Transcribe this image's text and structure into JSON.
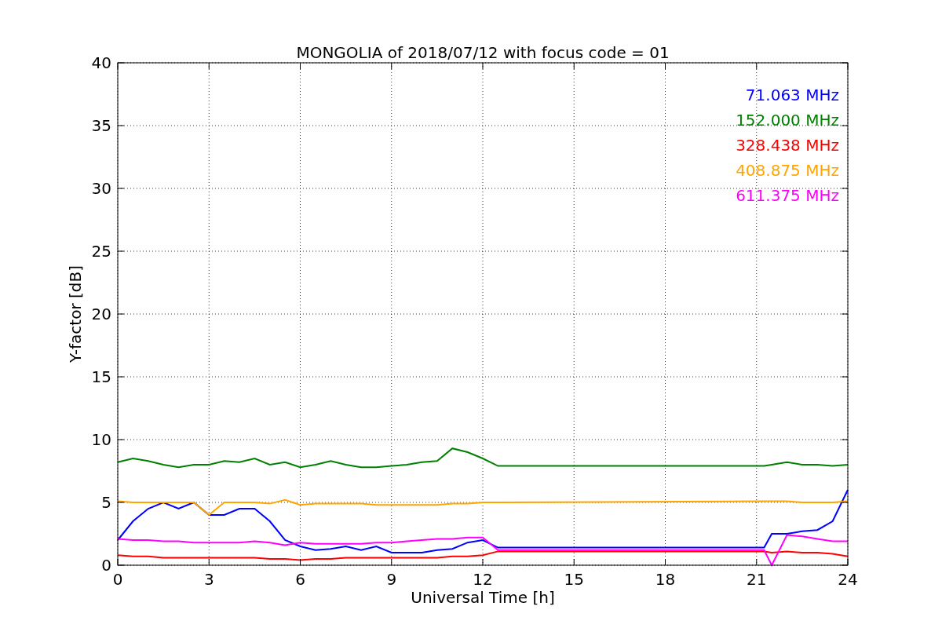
{
  "figure": {
    "chart_data": {
      "type": "line",
      "title": "MONGOLIA of 2018/07/12 with focus code = 01",
      "xlabel": "Universal Time [h]",
      "ylabel": "Y-factor [dB]",
      "xlim": [
        0,
        24
      ],
      "ylim": [
        0,
        40
      ],
      "xticks": [
        0,
        3,
        6,
        9,
        12,
        15,
        18,
        21,
        24
      ],
      "yticks": [
        0,
        5,
        10,
        15,
        20,
        25,
        30,
        35,
        40
      ],
      "grid": true,
      "x": [
        0,
        0.5,
        1,
        1.5,
        2,
        2.5,
        3,
        3.5,
        4,
        4.5,
        5,
        5.5,
        6,
        6.5,
        7,
        7.5,
        8,
        8.5,
        9,
        9.5,
        10,
        10.5,
        11,
        11.5,
        12,
        12.5,
        21.25,
        21.5,
        22,
        22.5,
        23,
        23.5,
        24
      ],
      "series": [
        {
          "name": "71.063 MHz",
          "color": "#0000ff",
          "values": [
            2,
            3.5,
            4.5,
            5,
            4.5,
            5,
            4,
            4,
            4.5,
            4.5,
            3.5,
            2,
            1.5,
            1.2,
            1.3,
            1.5,
            1.2,
            1.5,
            1,
            1,
            1,
            1.2,
            1.3,
            1.8,
            2,
            1.4,
            1.4,
            2.5,
            2.5,
            2.7,
            2.8,
            3.5,
            6
          ]
        },
        {
          "name": "152.000 MHz",
          "color": "#008000",
          "values": [
            8.2,
            8.5,
            8.3,
            8,
            7.8,
            8,
            8,
            8.3,
            8.2,
            8.5,
            8,
            8.2,
            7.8,
            8,
            8.3,
            8,
            7.8,
            7.8,
            7.9,
            8,
            8.2,
            8.3,
            9.3,
            9,
            8.5,
            7.9,
            7.9,
            8,
            8.2,
            8,
            8,
            7.9,
            8
          ]
        },
        {
          "name": "328.438 MHz",
          "color": "#ff0000",
          "values": [
            0.8,
            0.7,
            0.7,
            0.6,
            0.6,
            0.6,
            0.6,
            0.6,
            0.6,
            0.6,
            0.5,
            0.5,
            0.4,
            0.5,
            0.5,
            0.6,
            0.6,
            0.6,
            0.6,
            0.6,
            0.6,
            0.6,
            0.7,
            0.7,
            0.8,
            1.1,
            1.1,
            1.0,
            1.1,
            1.0,
            1.0,
            0.9,
            0.7
          ]
        },
        {
          "name": "408.875 MHz",
          "color": "#ffa500",
          "values": [
            5.1,
            5,
            5,
            5,
            5,
            5,
            4,
            5,
            5,
            5,
            4.9,
            5.2,
            4.8,
            4.9,
            4.9,
            4.9,
            4.9,
            4.8,
            4.8,
            4.8,
            4.8,
            4.8,
            4.9,
            4.9,
            5,
            5,
            5.1,
            5.1,
            5.1,
            5,
            5,
            5,
            5.1
          ]
        },
        {
          "name": "611.375 MHz",
          "color": "#ff00ff",
          "values": [
            2.1,
            2,
            2,
            1.9,
            1.9,
            1.8,
            1.8,
            1.8,
            1.8,
            1.9,
            1.8,
            1.6,
            1.8,
            1.7,
            1.7,
            1.7,
            1.7,
            1.8,
            1.8,
            1.9,
            2,
            2.1,
            2.1,
            2.2,
            2.2,
            1.2,
            1.2,
            0,
            2.4,
            2.3,
            2.1,
            1.9,
            1.9
          ]
        }
      ]
    }
  }
}
